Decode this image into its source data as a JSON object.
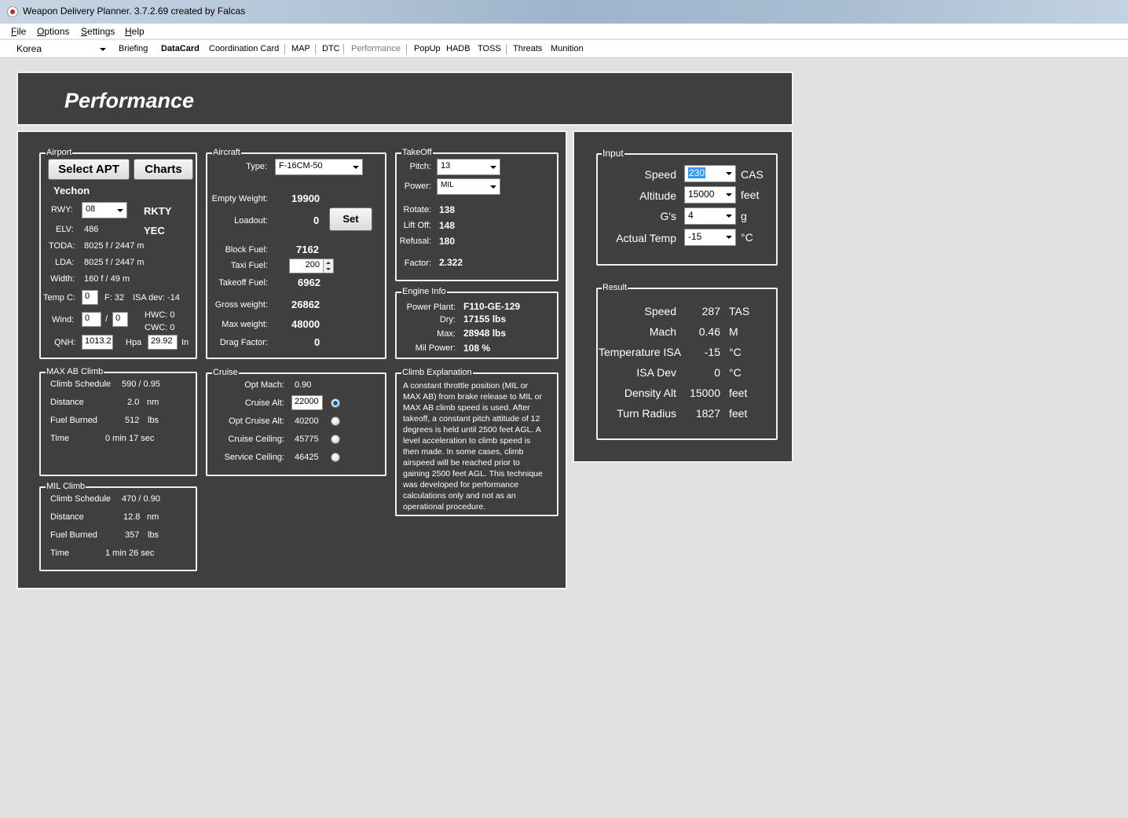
{
  "window": {
    "title": "Weapon Delivery Planner. 3.7.2.69 created by Falcas"
  },
  "menu": [
    {
      "first": "F",
      "rest": "ile"
    },
    {
      "first": "O",
      "rest": "ptions"
    },
    {
      "first": "S",
      "rest": "ettings"
    },
    {
      "first": "H",
      "rest": "elp"
    }
  ],
  "toolbar": {
    "region": "Korea",
    "items": [
      "Briefing",
      "DataCard",
      "Coordination Card",
      "MAP",
      "DTC",
      "Performance",
      "PopUp",
      "HADB",
      "TOSS",
      "Threats",
      "Munition"
    ]
  },
  "header": {
    "title": "Performance"
  },
  "airport": {
    "legend": "Airport",
    "select_btn": "Select APT",
    "charts_btn": "Charts",
    "name": "Yechon",
    "rwy_label": "RWY:",
    "rwy": "08",
    "icao": "RKTY",
    "elv_label": "ELV:",
    "elv": "486",
    "iata": "YEC",
    "toda_label": "TODA:",
    "toda": "8025 f / 2447 m",
    "lda_label": "LDA:",
    "lda": "8025 f / 2447 m",
    "width_label": "Width:",
    "width": "160 f / 49 m",
    "temp_label": "Temp C:",
    "temp_c": "0",
    "temp_f": "F: 32",
    "isa_dev": "ISA dev: -14",
    "wind_label": "Wind:",
    "wind_dir": "0",
    "wind_sep": "/",
    "wind_spd": "0",
    "hwc": "HWC: 0",
    "cwc": "CWC: 0",
    "qnh_label": "QNH:",
    "qnh_hpa": "1013.2",
    "hpa_unit": "Hpa",
    "qnh_in": "29.92",
    "in_unit": "In"
  },
  "aircraft": {
    "legend": "Aircraft",
    "type_label": "Type:",
    "type": "F-16CM-50",
    "empty_weight_label": "Empty Weight:",
    "empty_weight": "19900",
    "loadout_label": "Loadout:",
    "loadout": "0",
    "set_btn": "Set",
    "block_fuel_label": "Block Fuel:",
    "block_fuel": "7162",
    "taxi_fuel_label": "Taxi Fuel:",
    "taxi_fuel": "200",
    "takeoff_fuel_label": "Takeoff Fuel:",
    "takeoff_fuel": "6962",
    "gross_weight_label": "Gross weight:",
    "gross_weight": "26862",
    "max_weight_label": "Max weight:",
    "max_weight": "48000",
    "drag_factor_label": "Drag Factor:",
    "drag_factor": "0"
  },
  "takeoff": {
    "legend": "TakeOff",
    "pitch_label": "Pitch:",
    "pitch": "13",
    "power_label": "Power:",
    "power": "MIL",
    "rotate_label": "Rotate:",
    "rotate": "138",
    "liftoff_label": "Lift Off:",
    "liftoff": "148",
    "refusal_label": "Refusal:",
    "refusal": "180",
    "factor_label": "Factor:",
    "factor": "2.322"
  },
  "engine": {
    "legend": "Engine Info",
    "plant_label": "Power Plant:",
    "plant": "F110-GE-129",
    "dry_label": "Dry:",
    "dry": "17155 lbs",
    "max_label": "Max:",
    "max": "28948 lbs",
    "mil_label": "Mil Power:",
    "mil": "108 %"
  },
  "maxab": {
    "legend": "MAX AB Climb",
    "schedule_label": "Climb Schedule",
    "schedule": "590 / 0.95",
    "distance_label": "Distance",
    "distance": "2.0",
    "distance_unit": "nm",
    "fuel_label": "Fuel Burned",
    "fuel": "512",
    "fuel_unit": "lbs",
    "time_label": "Time",
    "time": "0 min 17 sec"
  },
  "mil": {
    "legend": "MIL Climb",
    "schedule_label": "Climb Schedule",
    "schedule": "470 / 0.90",
    "distance_label": "Distance",
    "distance": "12.8",
    "distance_unit": "nm",
    "fuel_label": "Fuel Burned",
    "fuel": "357",
    "fuel_unit": "lbs",
    "time_label": "Time",
    "time": "1 min 26 sec"
  },
  "cruise": {
    "legend": "Cruise",
    "opt_mach_label": "Opt Mach:",
    "opt_mach": "0.90",
    "cruise_alt_label": "Cruise Alt:",
    "cruise_alt": "22000",
    "opt_cruise_alt_label": "Opt Cruise Alt:",
    "opt_cruise_alt": "40200",
    "cruise_ceiling_label": "Cruise Ceiling:",
    "cruise_ceiling": "45775",
    "service_ceiling_label": "Service Ceiling:",
    "service_ceiling": "46425",
    "selected_radio": "cruise-alt"
  },
  "climb_explanation": {
    "legend": "Climb Explanation",
    "lines": [
      "A constant throttle position (MIL or",
      "MAX AB) from brake release to MIL or",
      "MAX AB climb speed is used. After",
      "takeoff, a constant pitch attitude of 12",
      "degrees is held until 2500 feet AGL. A",
      "level acceleration to climb speed is",
      "then made. In some cases, climb",
      "airspeed will be reached prior to",
      "gaining 2500 feet AGL. This technique",
      "was developed for performance",
      "calculations only and not as an",
      "operational procedure."
    ]
  },
  "input": {
    "legend": "Input",
    "speed_label": "Speed",
    "speed": "230",
    "speed_unit": "CAS",
    "altitude_label": "Altitude",
    "altitude": "15000",
    "altitude_unit": "feet",
    "gs_label": "G's",
    "gs": "4",
    "gs_unit": "g",
    "temp_label": "Actual Temp",
    "temp": "-15",
    "temp_unit": "°C"
  },
  "result": {
    "legend": "Result",
    "rows": [
      {
        "label": "Speed",
        "value": "287",
        "unit": "TAS"
      },
      {
        "label": "Mach",
        "value": "0.46",
        "unit": "M"
      },
      {
        "label": "Temperature ISA",
        "value": "-15",
        "unit": "°C"
      },
      {
        "label": "ISA Dev",
        "value": "0",
        "unit": "°C"
      },
      {
        "label": "Density Alt",
        "value": "15000",
        "unit": "feet"
      },
      {
        "label": "Turn Radius",
        "value": "1827",
        "unit": "feet"
      }
    ]
  },
  "colors": {
    "panel": "#3f3f3f",
    "border": "#f0f0f0",
    "selection": "#3399ff",
    "radio_dot": "#0f5e9e"
  }
}
